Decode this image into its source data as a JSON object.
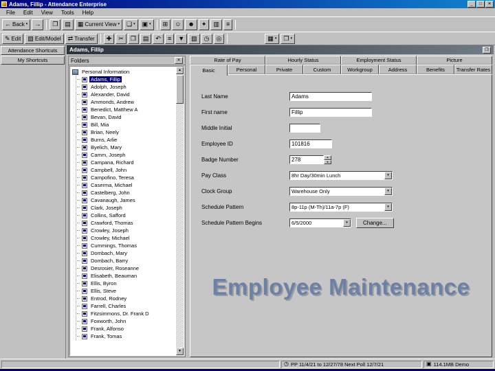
{
  "window": {
    "title": "Adams, Fillip - Attendance Enterprise"
  },
  "titlebar_buttons": {
    "minimize": "_",
    "maximize": "□",
    "close": "✕"
  },
  "menu": [
    "File",
    "Edit",
    "View",
    "Tools",
    "Help"
  ],
  "ui": {
    "dropdown_arrow": "▾",
    "spinner_up": "▴",
    "spinner_down": "▾",
    "scroll_up": "▲",
    "scroll_down": "▼"
  },
  "toolbar_main": [
    {
      "type": "button",
      "name": "back-button",
      "glyph": "←",
      "label": "Back",
      "arrow": true
    },
    {
      "type": "button",
      "name": "forward-button",
      "glyph": "→"
    },
    {
      "type": "sep"
    },
    {
      "type": "button",
      "name": "copy-page-button",
      "glyph": "❐"
    },
    {
      "type": "button",
      "name": "list-view-button",
      "glyph": "▤"
    },
    {
      "type": "combo",
      "name": "current-view-combo",
      "glyph": "▦",
      "label": "Current View"
    },
    {
      "type": "button",
      "name": "new-window-button",
      "glyph": "❏",
      "arrow": true
    },
    {
      "type": "button",
      "name": "options-button",
      "glyph": "▣",
      "arrow": true
    },
    {
      "type": "sep"
    },
    {
      "type": "button",
      "name": "calculator-button",
      "glyph": "⊞"
    },
    {
      "type": "button",
      "name": "employee-button",
      "glyph": "☺"
    },
    {
      "type": "button",
      "name": "group-button",
      "glyph": "☻"
    },
    {
      "type": "button",
      "name": "security-button",
      "glyph": "✦"
    },
    {
      "type": "button",
      "name": "reports-button",
      "glyph": "▥"
    },
    {
      "type": "button",
      "name": "print-button",
      "glyph": "≡"
    },
    {
      "type": "sep"
    }
  ],
  "toolbar_edit": [
    {
      "type": "button",
      "name": "edit-button",
      "glyph": "✎",
      "label": "Edit"
    },
    {
      "type": "button",
      "name": "edit-model-button",
      "glyph": "▧",
      "label": "Edit/Model"
    },
    {
      "type": "button",
      "name": "transfer-button",
      "glyph": "⇄",
      "label": "Transfer"
    },
    {
      "type": "sep"
    },
    {
      "type": "button",
      "name": "insert-button",
      "glyph": "✚"
    },
    {
      "type": "button",
      "name": "cut-button",
      "glyph": "✂"
    },
    {
      "type": "button",
      "name": "copy-button",
      "glyph": "❐"
    },
    {
      "type": "button",
      "name": "paste-button",
      "glyph": "▤"
    },
    {
      "type": "button",
      "name": "undo-button",
      "glyph": "↶"
    },
    {
      "type": "button",
      "name": "sort-button",
      "glyph": "≡"
    },
    {
      "type": "button",
      "name": "filter-button",
      "glyph": "▼"
    },
    {
      "type": "button",
      "name": "chart-button",
      "glyph": "▨"
    },
    {
      "type": "button",
      "name": "clock-button",
      "glyph": "◷"
    },
    {
      "type": "button",
      "name": "globe-button",
      "glyph": "◎"
    },
    {
      "type": "sep"
    },
    {
      "type": "gap"
    },
    {
      "type": "button",
      "name": "window-list-button",
      "glyph": "▦",
      "arrow": true
    },
    {
      "type": "button",
      "name": "help-pane-button",
      "glyph": "❒",
      "arrow": true
    }
  ],
  "sidebar": {
    "items": [
      {
        "label": "Attendance Shortcuts"
      },
      {
        "label": "My Shortcuts"
      }
    ]
  },
  "content_header": {
    "title": "Adams, Fillip",
    "button_glyph": "❒"
  },
  "folders": {
    "title": "Folders",
    "close_glyph": "✕",
    "root": "Personal Information",
    "employees": [
      "Adams, Fillip",
      "Adolph, Joseph",
      "Alexander, David",
      "Ammonds, Andrew",
      "Benedict, Matthew A",
      "Bevan, David",
      "Bill, Mia",
      "Brian, Neely",
      "Burns, Arlie",
      "Byelich, Mary",
      "Camm, Joseph",
      "Campana, Richard",
      "Campbell, John",
      "Campofino, Teresa",
      "Caserma, Michael",
      "Castelberg, John",
      "Cavanaugh, James",
      "Clark, Joseph",
      "Collins, Safford",
      "Crawford, Thomas",
      "Crowley, Joseph",
      "Crowley, Michael",
      "Cummings, Thomas",
      "Dombach, Mary",
      "Dombach, Barry",
      "Desrosier, Roseanne",
      "Elisabeth, Beauman",
      "Ellis, Byron",
      "Ellis, Steve",
      "Entrod, Rodney",
      "Farrell, Charles",
      "Fitzsimmons, Dr. Frank D",
      "Foxworth, John",
      "Frank, Alfonso",
      "Frank, Tomas"
    ],
    "selected": "Adams, Fillip"
  },
  "tabs": {
    "row1": [
      "Rate of Pay",
      "Hourly Status",
      "Employment Status",
      "Picture"
    ],
    "row2": [
      "Basic",
      "Personal",
      "Private",
      "Custom",
      "Workgroup",
      "Address",
      "Benefits",
      "Transfer Rates"
    ],
    "active": "Basic"
  },
  "form": {
    "fields": [
      {
        "label": "Last Name",
        "value": "Adams",
        "type": "text"
      },
      {
        "label": "First name",
        "value": "Fillip",
        "type": "text"
      },
      {
        "label": "Middle Initial",
        "value": "",
        "type": "text-short"
      },
      {
        "label": "Employee ID",
        "value": "101816",
        "type": "text-mid"
      },
      {
        "label": "Badge Number",
        "value": "278",
        "type": "spinner"
      },
      {
        "label": "Pay Class",
        "value": "8hr Day/30min Lunch",
        "type": "dropdown"
      },
      {
        "label": "Clock Group",
        "value": "Warehouse Only",
        "type": "dropdown"
      },
      {
        "label": "Schedule Pattern",
        "value": "8p-11p (M-Th)/11a-7p (F)",
        "type": "dropdown"
      },
      {
        "label": "Schedule Pattern Begins",
        "value": "6/5/2000",
        "type": "dropdown-date",
        "button": "Change..."
      }
    ]
  },
  "overlay_title": "Employee Maintenance",
  "statusbar": {
    "middle_icon": "◷",
    "middle": "PP 11/4/21 to 12/27/78  Next Poll 12/7/21",
    "right_icon": "▣",
    "right": "114.1MB Demo"
  }
}
